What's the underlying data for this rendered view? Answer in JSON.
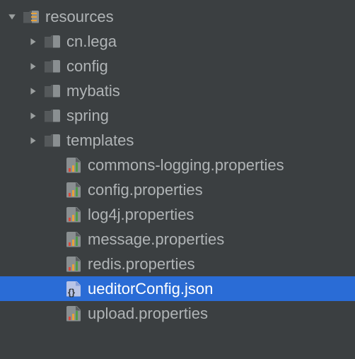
{
  "tree": {
    "root": {
      "label": "resources",
      "icon": "resources",
      "expanded": true
    },
    "folders": [
      {
        "label": "cn.lega",
        "icon": "folder",
        "expanded": false
      },
      {
        "label": "config",
        "icon": "folder",
        "expanded": false
      },
      {
        "label": "mybatis",
        "icon": "folder",
        "expanded": false
      },
      {
        "label": "spring",
        "icon": "folder",
        "expanded": false
      },
      {
        "label": "templates",
        "icon": "folder",
        "expanded": false
      }
    ],
    "files": [
      {
        "label": "commons-logging.properties",
        "icon": "properties",
        "selected": false
      },
      {
        "label": "config.properties",
        "icon": "properties",
        "selected": false
      },
      {
        "label": "log4j.properties",
        "icon": "properties",
        "selected": false
      },
      {
        "label": "message.properties",
        "icon": "properties",
        "selected": false
      },
      {
        "label": "redis.properties",
        "icon": "properties",
        "selected": false
      },
      {
        "label": "ueditorConfig.json",
        "icon": "json",
        "selected": true
      },
      {
        "label": "upload.properties",
        "icon": "properties",
        "selected": false
      }
    ]
  }
}
